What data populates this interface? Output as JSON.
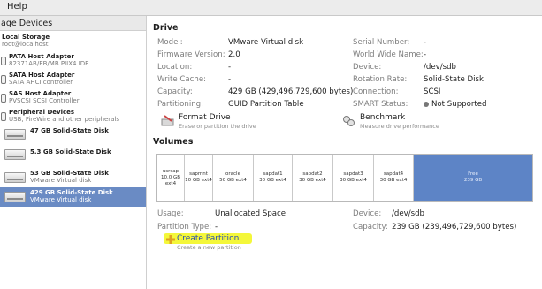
{
  "menu": {
    "help": "Help"
  },
  "sidebar": {
    "header": "age Devices",
    "items": [
      {
        "title": "Local Storage",
        "sub": "root@localhost",
        "kind": "host"
      },
      {
        "title": "PATA Host Adapter",
        "sub": "82371AB/EB/MB PIIX4 IDE",
        "kind": "adapter"
      },
      {
        "title": "SATA Host Adapter",
        "sub": "SATA AHCI controller",
        "kind": "adapter"
      },
      {
        "title": "SAS Host Adapter",
        "sub": "PVSCSI SCSI Controller",
        "kind": "adapter"
      },
      {
        "title": "Peripheral Devices",
        "sub": "USB, FireWire and other peripherals",
        "kind": "adapter"
      },
      {
        "title": "47 GB Solid-State Disk",
        "sub": "",
        "kind": "disk"
      },
      {
        "title": "5.3 GB Solid-State Disk",
        "sub": "",
        "kind": "disk"
      },
      {
        "title": "53 GB Solid-State Disk",
        "sub": "VMware Virtual disk",
        "kind": "disk"
      },
      {
        "title": "429 GB Solid-State Disk",
        "sub": "VMware Virtual disk",
        "kind": "disk",
        "selected": true
      }
    ]
  },
  "drive": {
    "heading": "Drive",
    "left": [
      {
        "label": "Model:",
        "value": "VMware Virtual disk"
      },
      {
        "label": "Firmware Version:",
        "value": "2.0"
      },
      {
        "label": "Location:",
        "value": "-"
      },
      {
        "label": "Write Cache:",
        "value": "-"
      },
      {
        "label": "Capacity:",
        "value": "429 GB (429,496,729,600 bytes)"
      },
      {
        "label": "Partitioning:",
        "value": "GUID Partition Table"
      }
    ],
    "right": [
      {
        "label": "Serial Number:",
        "value": "-"
      },
      {
        "label": "World Wide Name:",
        "value": "-"
      },
      {
        "label": "Device:",
        "value": "/dev/sdb"
      },
      {
        "label": "Rotation Rate:",
        "value": "Solid-State Disk"
      },
      {
        "label": "Connection:",
        "value": "SCSI"
      },
      {
        "label": "SMART Status:",
        "value": "Not Supported"
      }
    ],
    "actions": {
      "format_title": "Format Drive",
      "format_sub": "Erase or partition the drive",
      "bench_title": "Benchmark",
      "bench_sub": "Measure drive performance"
    }
  },
  "volumes": {
    "heading": "Volumes",
    "segments": [
      {
        "name": "usrsap",
        "size": "10.0 GB ext4"
      },
      {
        "name": "sapmnt",
        "size": "10 GB ext4"
      },
      {
        "name": "oracle",
        "size": "50 GB ext4"
      },
      {
        "name": "sapdat1",
        "size": "30 GB ext4"
      },
      {
        "name": "sapdat2",
        "size": "30 GB ext4"
      },
      {
        "name": "sapdat3",
        "size": "30 GB ext4"
      },
      {
        "name": "sapdat4",
        "size": "30 GB ext4"
      },
      {
        "name": "Free",
        "size": "239 GB",
        "free": true
      }
    ],
    "details": {
      "usage_label": "Usage:",
      "usage_value": "Unallocated Space",
      "ptype_label": "Partition Type:",
      "ptype_value": "-",
      "device_label": "Device:",
      "device_value": "/dev/sdb",
      "capacity_label": "Capacity:",
      "capacity_value": "239 GB (239,496,729,600 bytes)"
    },
    "create": {
      "title": "Create Partition",
      "sub": "Create a new partition"
    }
  },
  "colors": {
    "selection": "#6a8bc4",
    "free_space": "#5d84c6",
    "highlight": "#f4f73a"
  }
}
